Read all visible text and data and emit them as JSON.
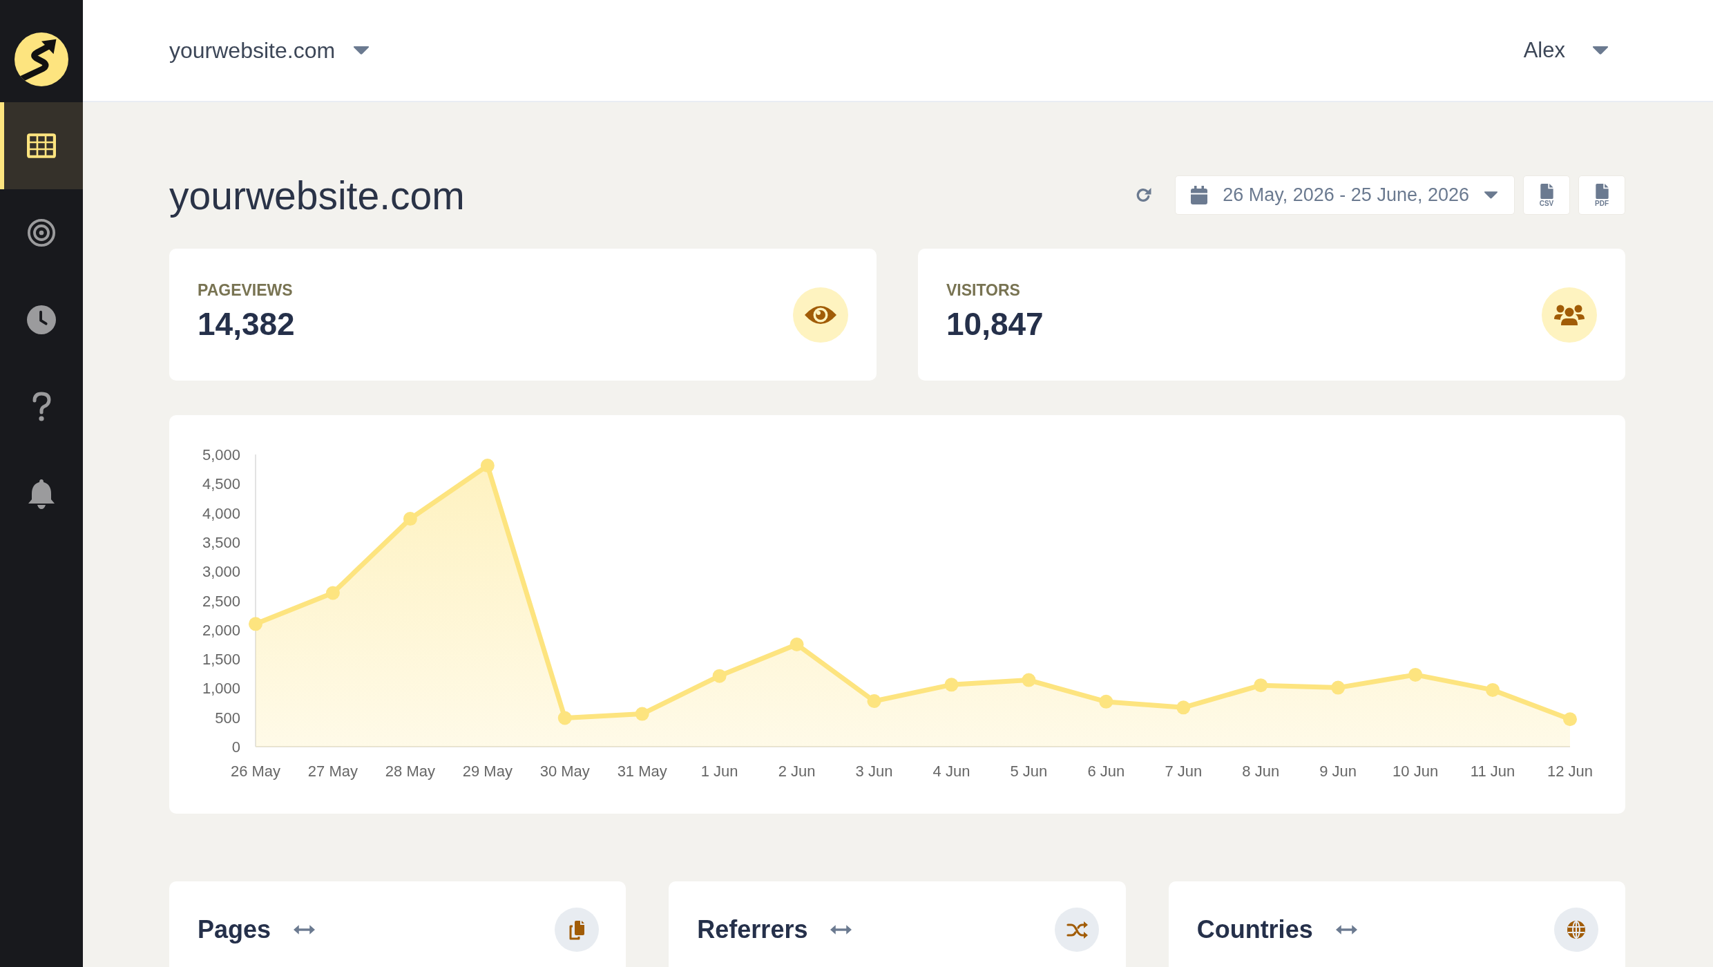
{
  "sidebar": {
    "items": [
      {
        "selected": true
      },
      {
        "selected": false
      },
      {
        "selected": false
      },
      {
        "selected": false
      },
      {
        "selected": false
      }
    ]
  },
  "header": {
    "site_selector": "yourwebsite.com",
    "user_menu": "Alex"
  },
  "toolbar": {
    "title": "yourwebsite.com",
    "date_range": "26 May, 2026 - 25 June, 2026",
    "export_buttons": [
      {
        "label": "CSV"
      },
      {
        "label": "PDF"
      }
    ]
  },
  "stats": [
    {
      "label": "PAGEVIEWS",
      "value": "14,382"
    },
    {
      "label": "VISITORS",
      "value": "10,847"
    }
  ],
  "chart": {
    "chart_data": {
      "type": "area",
      "categories": [
        "26 May",
        "27 May",
        "28 May",
        "29 May",
        "30 May",
        "31 May",
        "1 Jun",
        "2 Jun",
        "3 Jun",
        "4 Jun",
        "5 Jun",
        "6 Jun",
        "7 Jun",
        "8 Jun",
        "9 Jun",
        "10 Jun",
        "11 Jun",
        "12 Jun"
      ],
      "series": [
        {
          "color": "#fde47f",
          "values": [
            2100,
            2630,
            3900,
            4810,
            490,
            560,
            1210,
            1750,
            780,
            1060,
            1140,
            770,
            670,
            1050,
            1010,
            1230,
            970,
            470
          ]
        }
      ],
      "ylim": [
        0,
        5000
      ],
      "yticks": [
        0,
        500,
        {
          "value": 1000,
          "label": "1,000"
        },
        {
          "value": 1500,
          "label": "1,500"
        },
        {
          "value": 2000,
          "label": "2,000"
        },
        {
          "value": 2500,
          "label": "2,500"
        },
        {
          "value": 3000,
          "label": "3,000"
        },
        {
          "value": 3500,
          "label": "3,500"
        },
        {
          "value": 4000,
          "label": "4,000"
        },
        {
          "value": 4500,
          "label": "4,500"
        },
        {
          "value": 5000,
          "label": "5,000"
        }
      ]
    }
  },
  "panels": [
    {
      "title": "Pages"
    },
    {
      "title": "Referrers"
    },
    {
      "title": "Countries"
    }
  ]
}
